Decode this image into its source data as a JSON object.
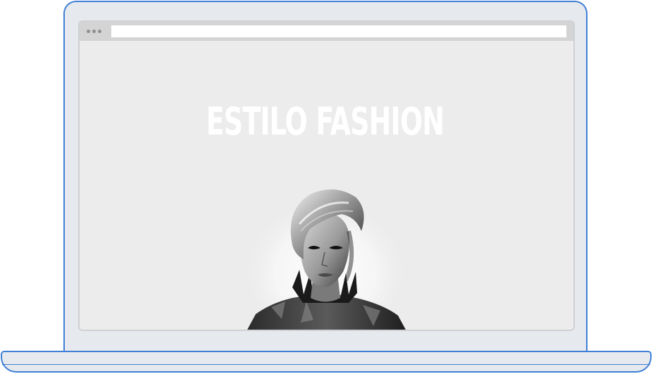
{
  "browser": {
    "address_value": ""
  },
  "page": {
    "title": "ESTILO FASHION",
    "hero_image": "fashion-model-portrait"
  },
  "colors": {
    "device_outline": "#3f7fd6",
    "device_body": "#e6e9ee",
    "browser_background": "#ececec",
    "title_color": "#ffffff"
  }
}
